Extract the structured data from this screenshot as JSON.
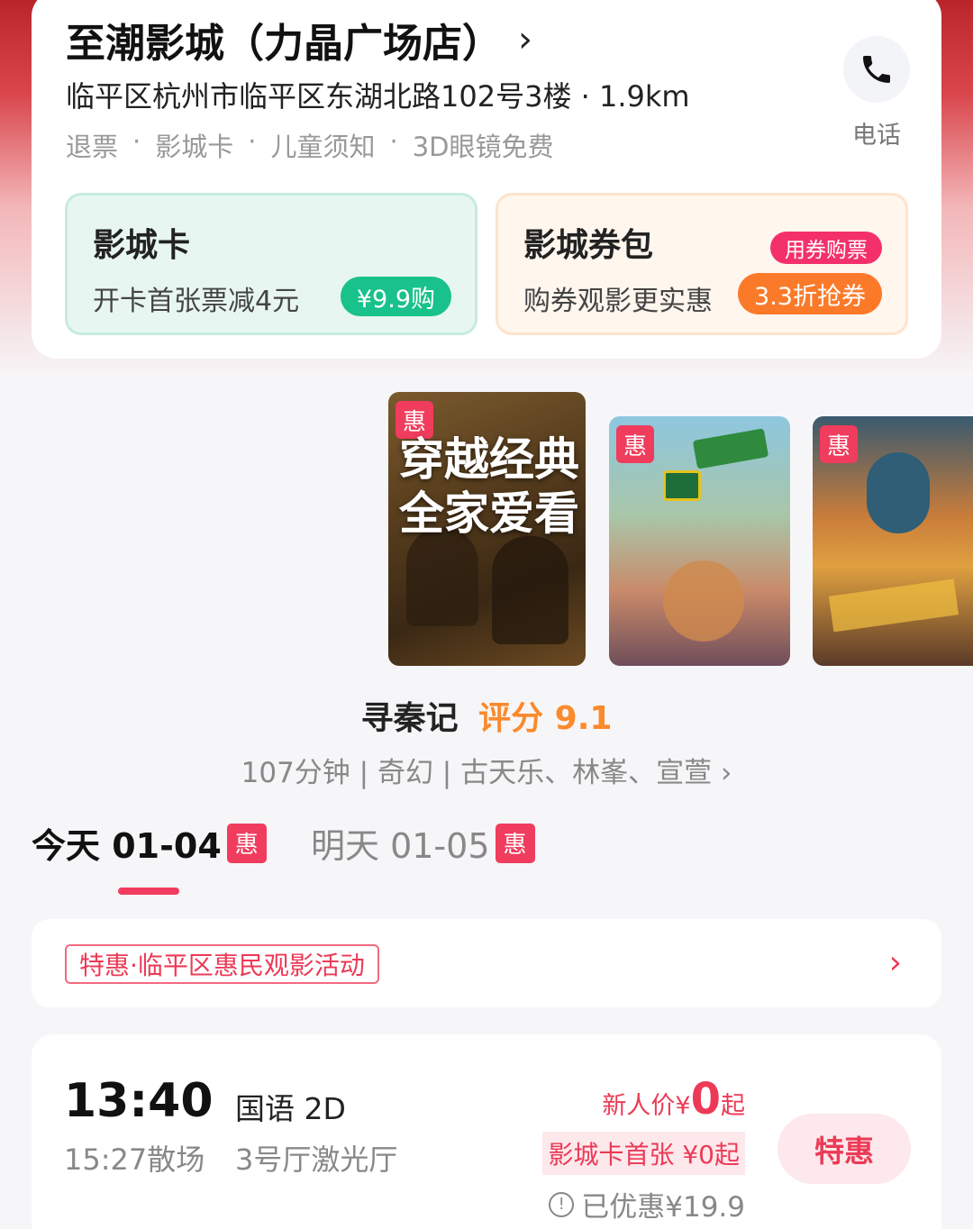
{
  "cinema": {
    "name": "至潮影城（力晶广场店）",
    "chevron": "›",
    "address": "临平区杭州市临平区东湖北路102号3楼 · 1.9km",
    "tags": [
      "退票",
      "影城卡",
      "儿童须知",
      "3D眼镜免费"
    ],
    "tag_sep": "·",
    "phone_label": "电话"
  },
  "benefits": {
    "card": {
      "title": "影城卡",
      "subtitle": "开卡首张票减4元",
      "button": "¥9.9购"
    },
    "voucher": {
      "title": "影城券包",
      "subtitle": "购券观影更实惠",
      "tag": "用券购票",
      "button": "3.3折抢券"
    }
  },
  "posters": [
    {
      "badge": "惠",
      "text_line1": "穿越经典",
      "text_line2": "全家爱看"
    },
    {
      "badge": "惠"
    },
    {
      "badge": "惠"
    }
  ],
  "movie": {
    "title": "寻秦记",
    "score_label": "评分 9.1",
    "meta": "107分钟 | 奇幻 | 古天乐、林峯、宣萱 ›"
  },
  "dates": [
    {
      "label": "今天 01-04",
      "badge": "惠"
    },
    {
      "label": "明天 01-05",
      "badge": "惠"
    }
  ],
  "promo": {
    "tag": "特惠·临平区惠民观影活动",
    "arrow": "›"
  },
  "session": {
    "start": "13:40",
    "end": "15:27散场",
    "lang": "国语 2D",
    "hall": "3号厅激光厅",
    "price_prefix": "新人价¥",
    "price_big": "0",
    "price_suffix": "起",
    "card_price": "影城卡首张 ¥0起",
    "saved": "已优惠¥19.9",
    "button": "特惠"
  },
  "colors": {
    "accent": "#f03c5d",
    "green": "#18c28a",
    "orange": "#fb7a2a",
    "score": "#fb8a2b"
  }
}
